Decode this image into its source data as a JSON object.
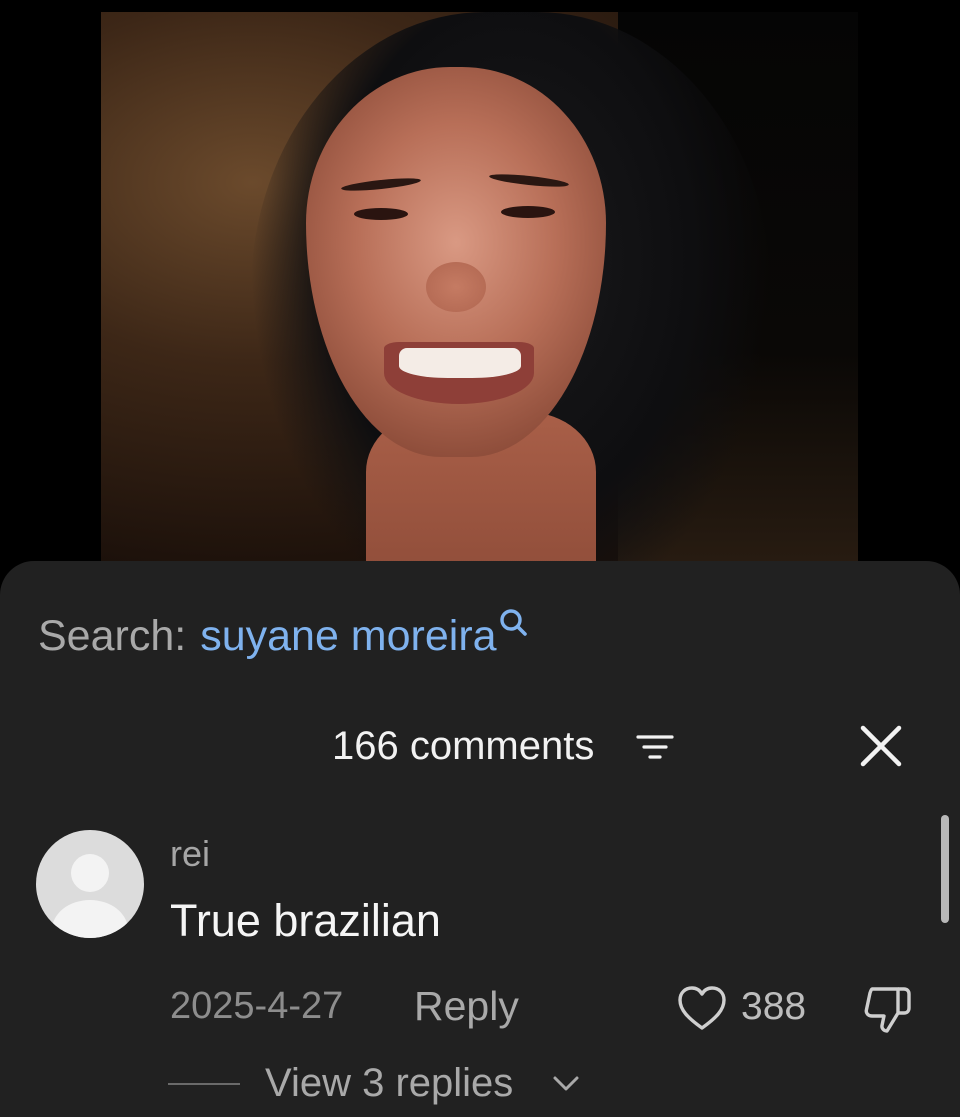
{
  "search": {
    "prefix": "Search:",
    "query": "suyane moreira",
    "icon": "search-icon"
  },
  "comments_panel": {
    "count_label": "166 comments",
    "sort_icon": "sort-lines-icon",
    "close_icon": "close-icon"
  },
  "comment": {
    "username": "rei",
    "text": "True brazilian",
    "date": "2025-4-27",
    "reply_label": "Reply",
    "like_count": "388",
    "view_replies_label": "View 3 replies"
  },
  "colors": {
    "sheet_background": "#212121",
    "search_query": "#7fb2ee",
    "primary_text": "#f5f5f5",
    "secondary_text": "#a9a9a9"
  }
}
